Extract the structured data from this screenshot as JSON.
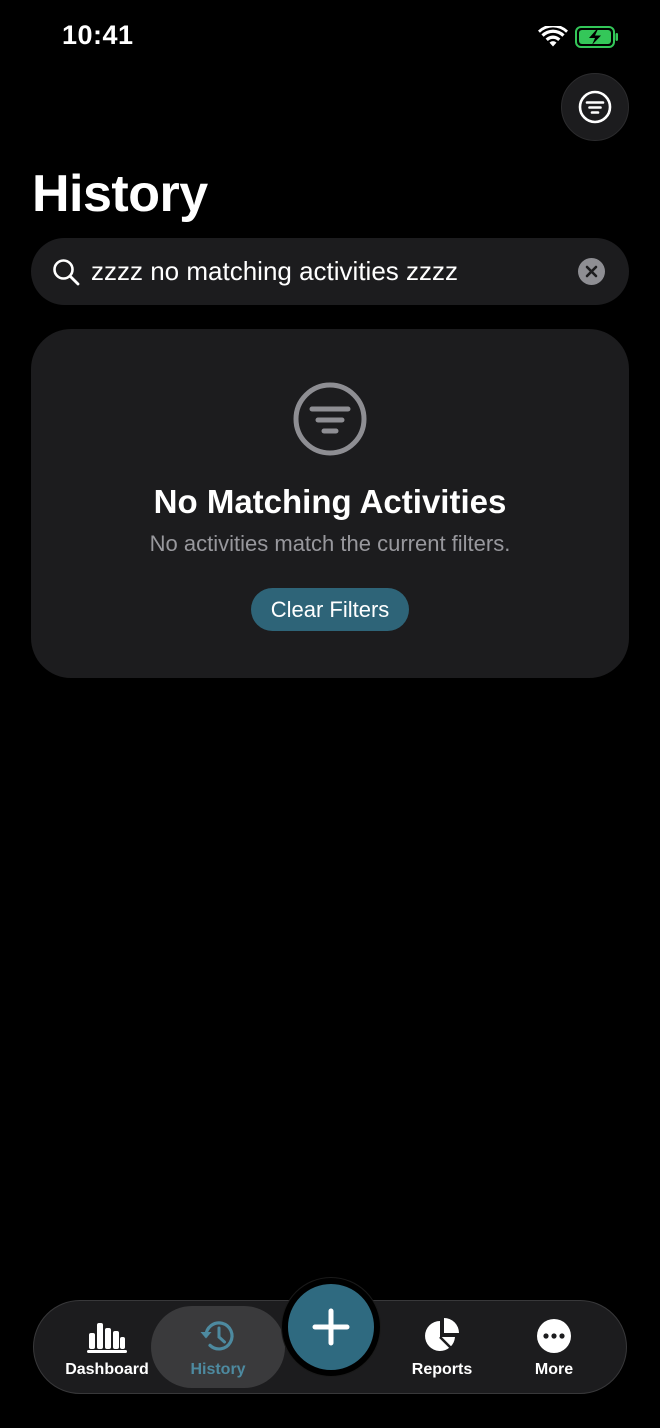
{
  "status_bar": {
    "time": "10:41",
    "icons": [
      "wifi-icon",
      "battery-charging-icon"
    ],
    "battery_color": "#34c759"
  },
  "header": {
    "title": "History",
    "filter_icon": "filter-lines-icon"
  },
  "search": {
    "value": "zzzz no matching activities zzzz",
    "placeholder": "Search",
    "icon": "search-icon",
    "clear_icon": "clear-x-icon"
  },
  "empty_state": {
    "icon": "filter-lines-icon",
    "title": "No Matching Activities",
    "subtitle": "No activities match the current filters.",
    "button_label": "Clear Filters"
  },
  "tab_bar": {
    "tabs": [
      {
        "label": "Dashboard",
        "icon": "bar-chart-icon",
        "active": false
      },
      {
        "label": "History",
        "icon": "history-clock-icon",
        "active": true
      },
      {
        "label": "Reports",
        "icon": "pie-chart-icon",
        "active": false
      },
      {
        "label": "More",
        "icon": "more-dots-icon",
        "active": false
      }
    ],
    "add_icon": "plus-icon"
  },
  "colors": {
    "accent": "#2f6a80",
    "active_tab_label": "#4d8aa0",
    "card_background": "#1c1c1e",
    "secondary_text": "#98989d"
  }
}
